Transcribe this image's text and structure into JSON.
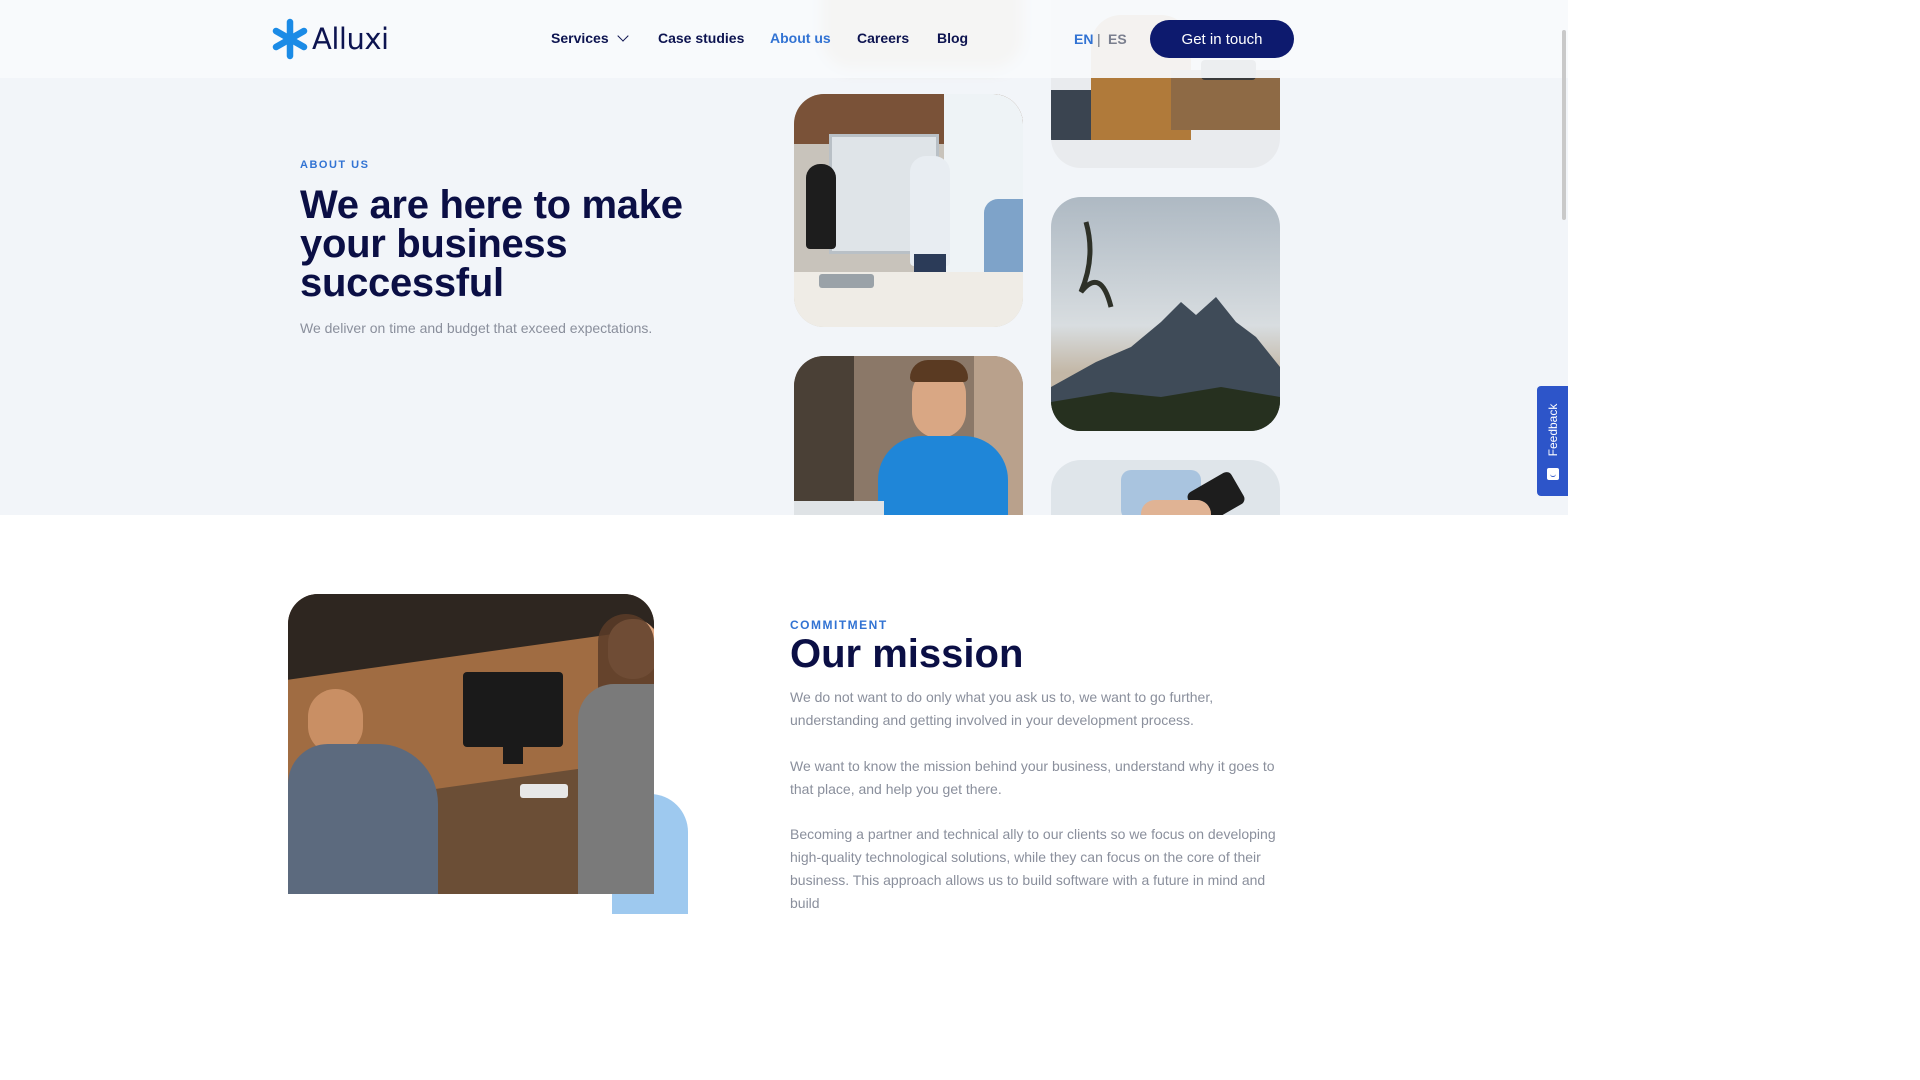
{
  "header": {
    "logo_text": "Alluxi",
    "nav": {
      "services": "Services",
      "case_studies": "Case studies",
      "about_us": "About us",
      "careers": "Careers",
      "blog": "Blog"
    },
    "lang_en": "EN",
    "lang_separator": "|",
    "lang_es": "ES",
    "cta": "Get in touch",
    "active_nav": "About us"
  },
  "hero": {
    "eyebrow": "ABOUT US",
    "title": "We are here to make your business successful",
    "subtitle": "We deliver on time and budget that exceed expectations."
  },
  "mission": {
    "eyebrow": "COMMITMENT",
    "title": "Our mission",
    "paragraphs": [
      "We do not want to do only what you ask us to, we want to go further, understanding and getting involved in your development process.",
      "We want to know the mission behind your business, understand why it goes to that place, and help you get there.",
      "Becoming a partner and technical ally to our clients so we focus on developing high-quality technological solutions, while they can focus on the core of their business. This approach allows us to build software with a future in mind and build"
    ]
  },
  "feedback": {
    "label": "Feedback"
  },
  "icons": {
    "logo": "asterisk-logo-icon",
    "services_dropdown": "chevron-down-icon",
    "feedback": "smiley-icon"
  },
  "colors": {
    "brand_navy": "#0d1a6e",
    "accent_blue": "#3273d3",
    "heading": "#0b0f45",
    "hero_bg": "#f2f5f9",
    "feedback_bg": "#2d55c9",
    "accent_light_blue": "#9ec9ef"
  }
}
